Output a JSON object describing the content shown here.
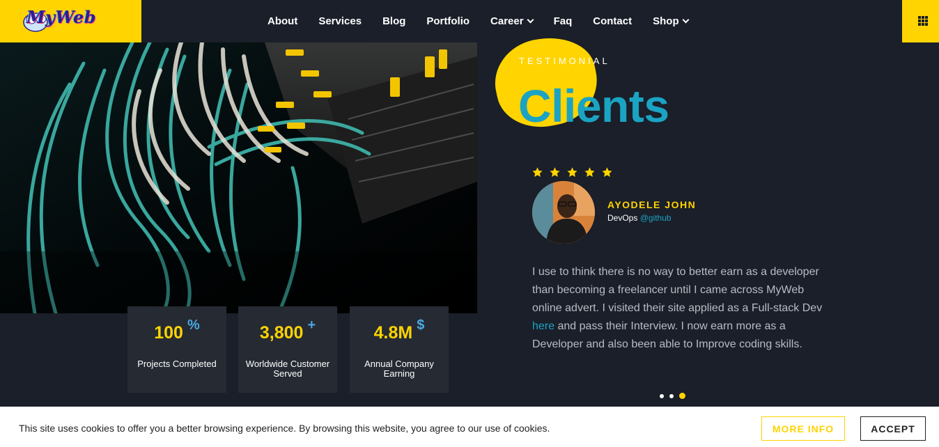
{
  "brand": {
    "logo_text": "MyWeb"
  },
  "nav": {
    "items": [
      {
        "label": "About",
        "dropdown": false
      },
      {
        "label": "Services",
        "dropdown": false
      },
      {
        "label": "Blog",
        "dropdown": false
      },
      {
        "label": "Portfolio",
        "dropdown": false
      },
      {
        "label": "Career",
        "dropdown": true
      },
      {
        "label": "Faq",
        "dropdown": false
      },
      {
        "label": "Contact",
        "dropdown": false
      },
      {
        "label": "Shop",
        "dropdown": true
      }
    ],
    "menu_icon": "grid-icon"
  },
  "stats": [
    {
      "value": "100",
      "suffix": "%",
      "label": "Projects Completed"
    },
    {
      "value": "3,800",
      "suffix": "+",
      "label": "Worldwide Customer Served"
    },
    {
      "value": "4.8M",
      "suffix": "$",
      "label": "Annual Company Earning"
    }
  ],
  "testimonial": {
    "eyebrow": "TESTIMONIAL",
    "title": "Clients",
    "rating": 5,
    "name": "AYODELE JOHN",
    "role": "DevOps",
    "handle": "@github",
    "quote_before": "I use to think there is no way to better earn as a developer than becoming a freelancer until I came across MyWeb online advert. I visited their site applied as a Full-stack Dev ",
    "quote_link": "here",
    "quote_after": " and pass their Interview. I now earn more as a Developer and also been able to Improve coding skills.",
    "slides": 3,
    "active_slide": 3
  },
  "cookie": {
    "text": "This site uses cookies to offer you a better browsing experience. By browsing this website, you agree to our use of cookies.",
    "more_label": "MORE INFO",
    "accept_label": "ACCEPT"
  },
  "colors": {
    "accent": "#ffd400",
    "teal": "#1ba3c3",
    "background": "#1a1f29",
    "card": "#252a33"
  }
}
